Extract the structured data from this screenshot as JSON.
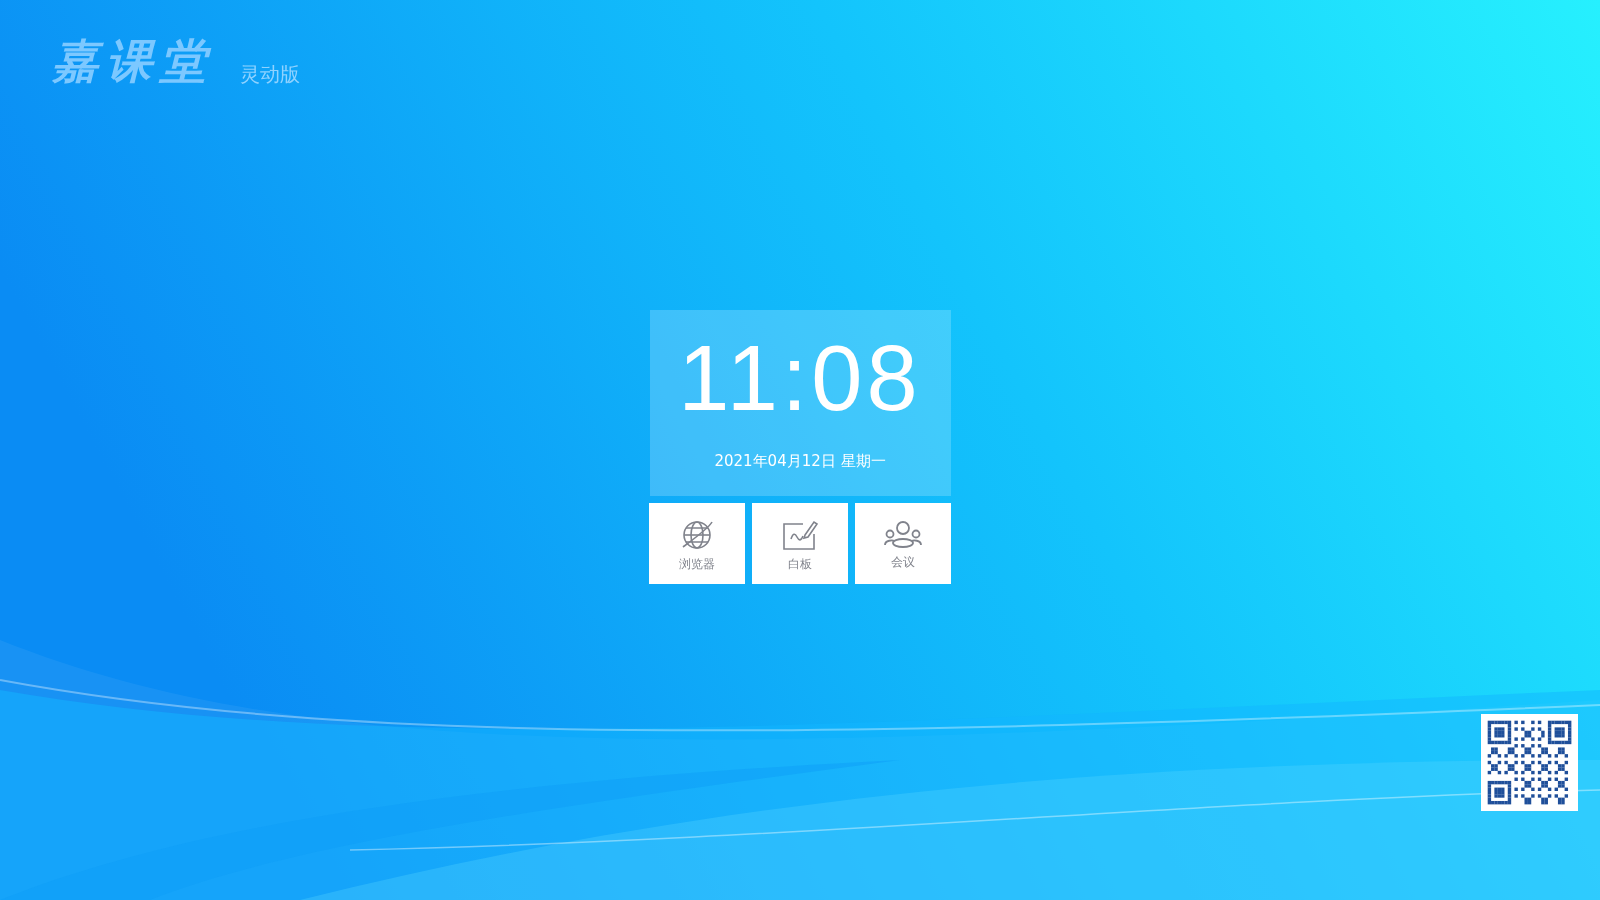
{
  "logo": {
    "title": "嘉课堂",
    "edition": "灵动版"
  },
  "clock": {
    "time": "11:08",
    "date": "2021年04月12日 星期一"
  },
  "apps": [
    {
      "label": "浏览器",
      "kind": "browser"
    },
    {
      "label": "白板",
      "kind": "whiteboard"
    },
    {
      "label": "会议",
      "kind": "meeting"
    }
  ]
}
